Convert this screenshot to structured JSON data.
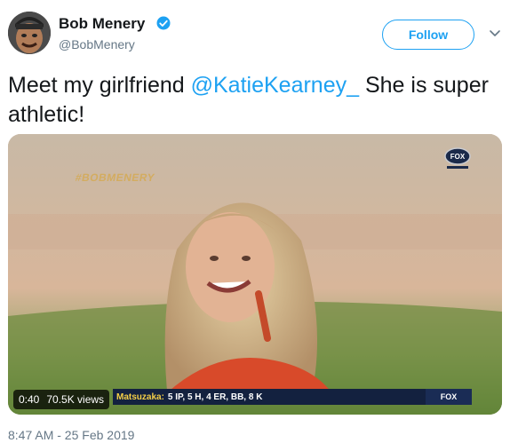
{
  "author": {
    "name": "Bob Menery",
    "handle": "@BobMenery",
    "avatar_icon": "profile-avatar",
    "verified_icon": "verified-badge-icon"
  },
  "actions": {
    "follow_label": "Follow",
    "more_icon": "chevron-down-icon"
  },
  "tweet": {
    "text_before": "Meet my girlfriend ",
    "mention": "@KatieKearney_",
    "text_after": " She is super athletic!"
  },
  "video": {
    "time": "0:40",
    "views": "70.5K views",
    "ticker_player": "Matsuzaka:",
    "ticker_stats": "5 IP, 5 H, 4 ER, BB, 8 K",
    "ticker_brand": "FOX",
    "watermark": "#BOBMENERY",
    "network_logo": "FOX"
  },
  "meta": {
    "timestamp": "8:47 AM - 25 Feb 2019"
  },
  "colors": {
    "accent": "#1da1f2",
    "text": "#14171a",
    "secondary_text": "#657786"
  }
}
